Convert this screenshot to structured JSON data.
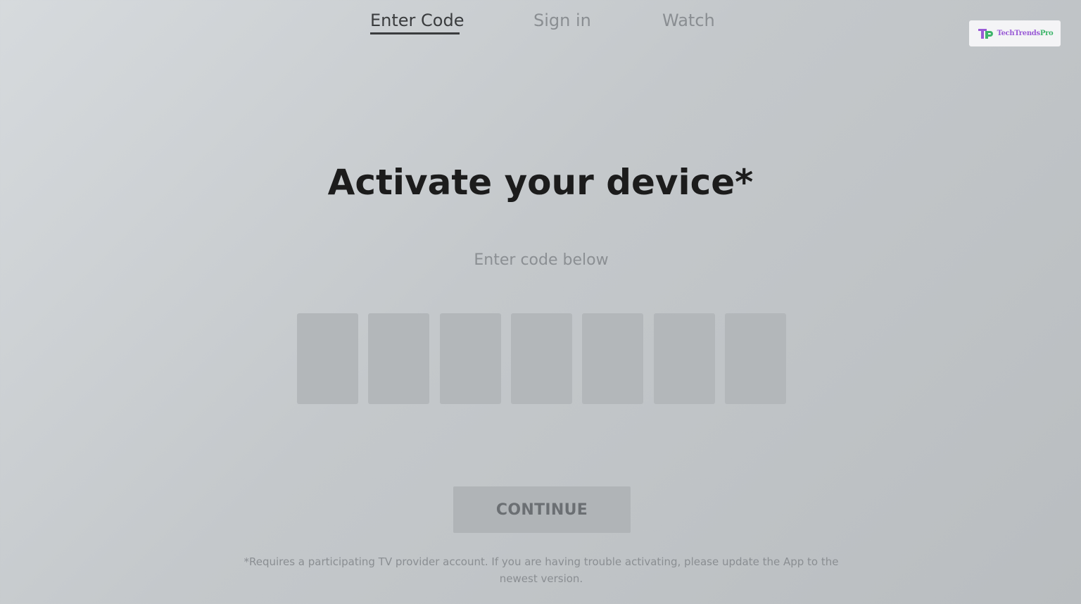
{
  "nav": {
    "tabs": [
      {
        "label": "Enter Code",
        "active": true
      },
      {
        "label": "Sign in",
        "active": false
      },
      {
        "label": "Watch",
        "active": false
      }
    ]
  },
  "watermark": {
    "text_main": "TechTrends",
    "text_accent": "Pro",
    "icon": "tp-logo-icon"
  },
  "main": {
    "title": "Activate your device*",
    "subtitle": "Enter code below",
    "code_length": 7,
    "code_values": [
      "",
      "",
      "",
      "",
      "",
      "",
      ""
    ],
    "continue_label": "CONTINUE",
    "footnote": "*Requires a participating TV provider account. If you are having trouble activating, please update the App to the newest version."
  },
  "colors": {
    "background": "#c4c8cb",
    "code_box": "#b3b7ba",
    "button": "#b0b4b7",
    "title_text": "#1c1c1c",
    "muted_text": "#8a8e92",
    "logo_purple": "#9a5bd6",
    "logo_green": "#3fb56b"
  }
}
